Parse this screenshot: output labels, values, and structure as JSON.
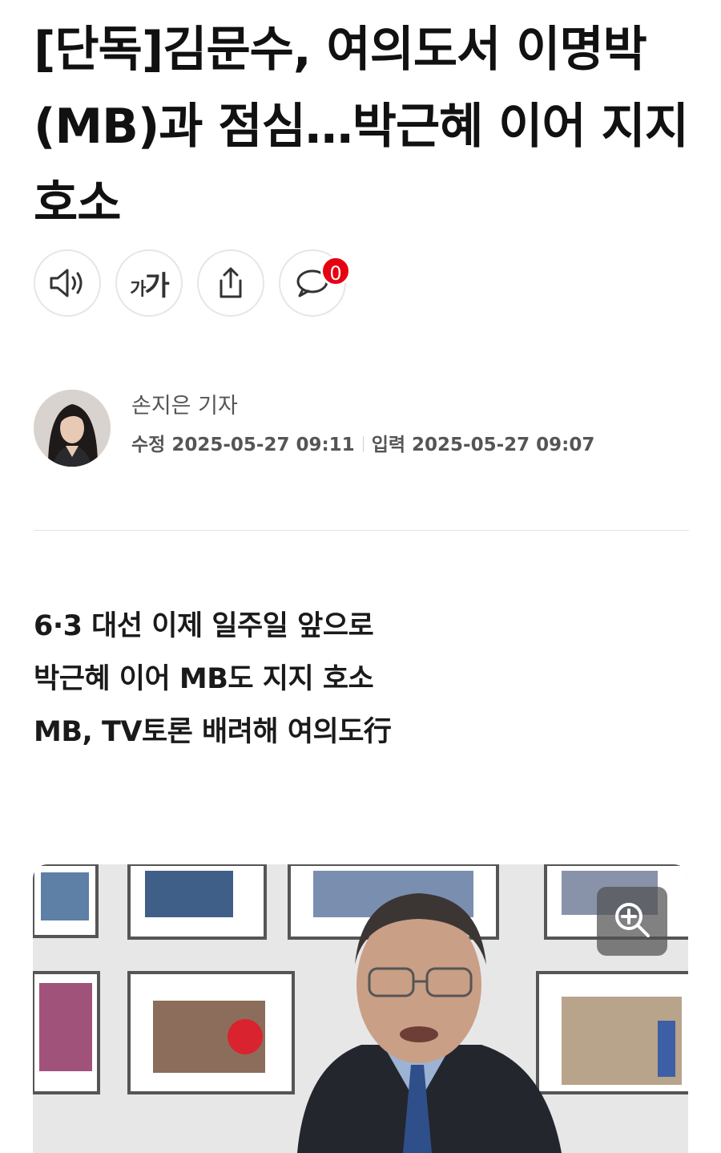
{
  "article": {
    "headline": "[단독]김문수, 여의도서 이명박(MB)과 점심…박근혜 이어 지지 호소",
    "toolbar": {
      "comment_count": "0"
    },
    "author": {
      "name": "손지은 기자",
      "modified_label": "수정",
      "modified": "2025-05-27 09:11",
      "published_label": "입력",
      "published": "2025-05-27 09:07"
    },
    "summary": [
      "6·3 대선 이제 일주일 앞으로",
      "박근혜 이어 MB도 지지 호소",
      "MB, TV토론 배려해 여의도行"
    ]
  },
  "icons": {
    "listen": "speaker-icon",
    "font_size": "font-size-icon",
    "share": "share-icon",
    "comment": "comment-icon",
    "zoom": "zoom-in-icon"
  },
  "colors": {
    "badge": "#e60012",
    "text": "#111111",
    "meta": "#555555"
  }
}
